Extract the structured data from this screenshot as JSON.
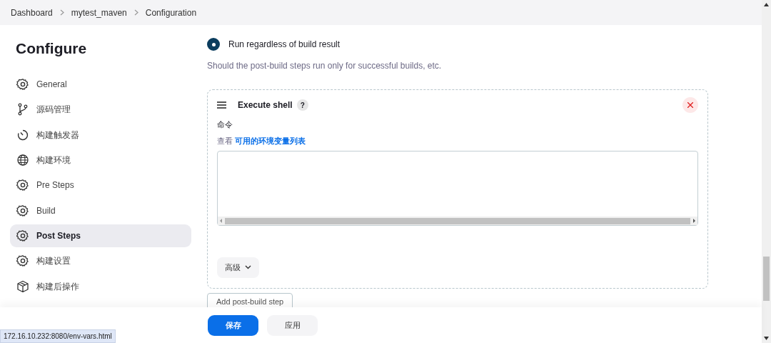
{
  "breadcrumbs": [
    {
      "label": "Dashboard"
    },
    {
      "label": "mytest_maven"
    },
    {
      "label": "Configuration"
    }
  ],
  "sidebar": {
    "title": "Configure",
    "items": [
      {
        "label": "General",
        "kind": "gear",
        "selected": false
      },
      {
        "label": "源码管理",
        "kind": "branch",
        "selected": false
      },
      {
        "label": "构建触发器",
        "kind": "clock",
        "selected": false
      },
      {
        "label": "构建环境",
        "kind": "globe",
        "selected": false
      },
      {
        "label": "Pre Steps",
        "kind": "gear",
        "selected": false
      },
      {
        "label": "Build",
        "kind": "gear",
        "selected": false
      },
      {
        "label": "Post Steps",
        "kind": "gear",
        "selected": true
      },
      {
        "label": "构建设置",
        "kind": "gear",
        "selected": false
      },
      {
        "label": "构建后操作",
        "kind": "package",
        "selected": false
      }
    ]
  },
  "radio": {
    "label": "Run regardless of build result",
    "checked": true
  },
  "description": "Should the post-build steps run only for successful builds, etc.",
  "step": {
    "title": "Execute shell",
    "help": "?",
    "command_label": "命令",
    "env_prefix": "查看",
    "env_link": "可用的环境变量列表",
    "advanced": "高级"
  },
  "add_button": "Add post-build step",
  "footer": {
    "save": "保存",
    "apply": "应用"
  },
  "status_url": "172.16.10.232:8080/env-vars.html"
}
